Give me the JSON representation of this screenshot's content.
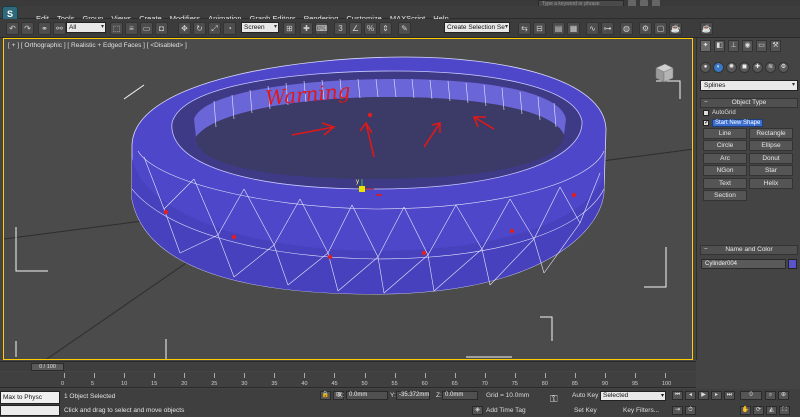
{
  "app": {
    "logo_letter": "S"
  },
  "menu": [
    "Edit",
    "Tools",
    "Group",
    "Views",
    "Create",
    "Modifiers",
    "Animation",
    "Graph Editors",
    "Rendering",
    "Customize",
    "MAXScript",
    "Help"
  ],
  "search": {
    "placeholder": "Type a keyword or phrase"
  },
  "toolbar": {
    "selection_filter": "All",
    "coord_system": "Screen",
    "named_selection": "Create Selection Se"
  },
  "viewport": {
    "label": "[ + ] [ Orthographic ] [ Realistic + Edged Faces ] [ <Disabled> ]",
    "annotation": "Warning",
    "object_color": "#4b46c8"
  },
  "command_panel": {
    "category": "Splines",
    "object_type_title": "Object Type",
    "autogrid_label": "AutoGrid",
    "start_new_shape_label": "Start New Shape",
    "start_new_shape_checked": true,
    "shapes": [
      [
        "Line",
        "Rectangle"
      ],
      [
        "Circle",
        "Ellipse"
      ],
      [
        "Arc",
        "Donut"
      ],
      [
        "NGon",
        "Star"
      ],
      [
        "Text",
        "Helix"
      ],
      [
        "Section",
        ""
      ]
    ],
    "name_color_title": "Name and Color",
    "object_name": "Cylinder004",
    "object_color": "#5b54cf"
  },
  "timeline": {
    "slider_label": "0 / 100",
    "ticks": [
      "0",
      "5",
      "10",
      "15",
      "20",
      "25",
      "30",
      "35",
      "40",
      "45",
      "50",
      "55",
      "60",
      "65",
      "70",
      "75",
      "80",
      "85",
      "90",
      "95",
      "100"
    ]
  },
  "status": {
    "maxscript_text": "Max to Physc",
    "selected_text": "1 Object Selected",
    "prompt_text": "Click and drag to select and move objects",
    "x_label": "X:",
    "x_value": "0.0mm",
    "y_label": "Y:",
    "y_value": "-35.372mm",
    "z_label": "Z:",
    "z_value": "0.0mm",
    "grid_text": "Grid = 10.0mm",
    "add_time_tag": "Add Time Tag",
    "auto_key": "Auto Key",
    "set_key": "Set Key",
    "key_mode": "Selected",
    "key_filters": "Key Filters..."
  }
}
